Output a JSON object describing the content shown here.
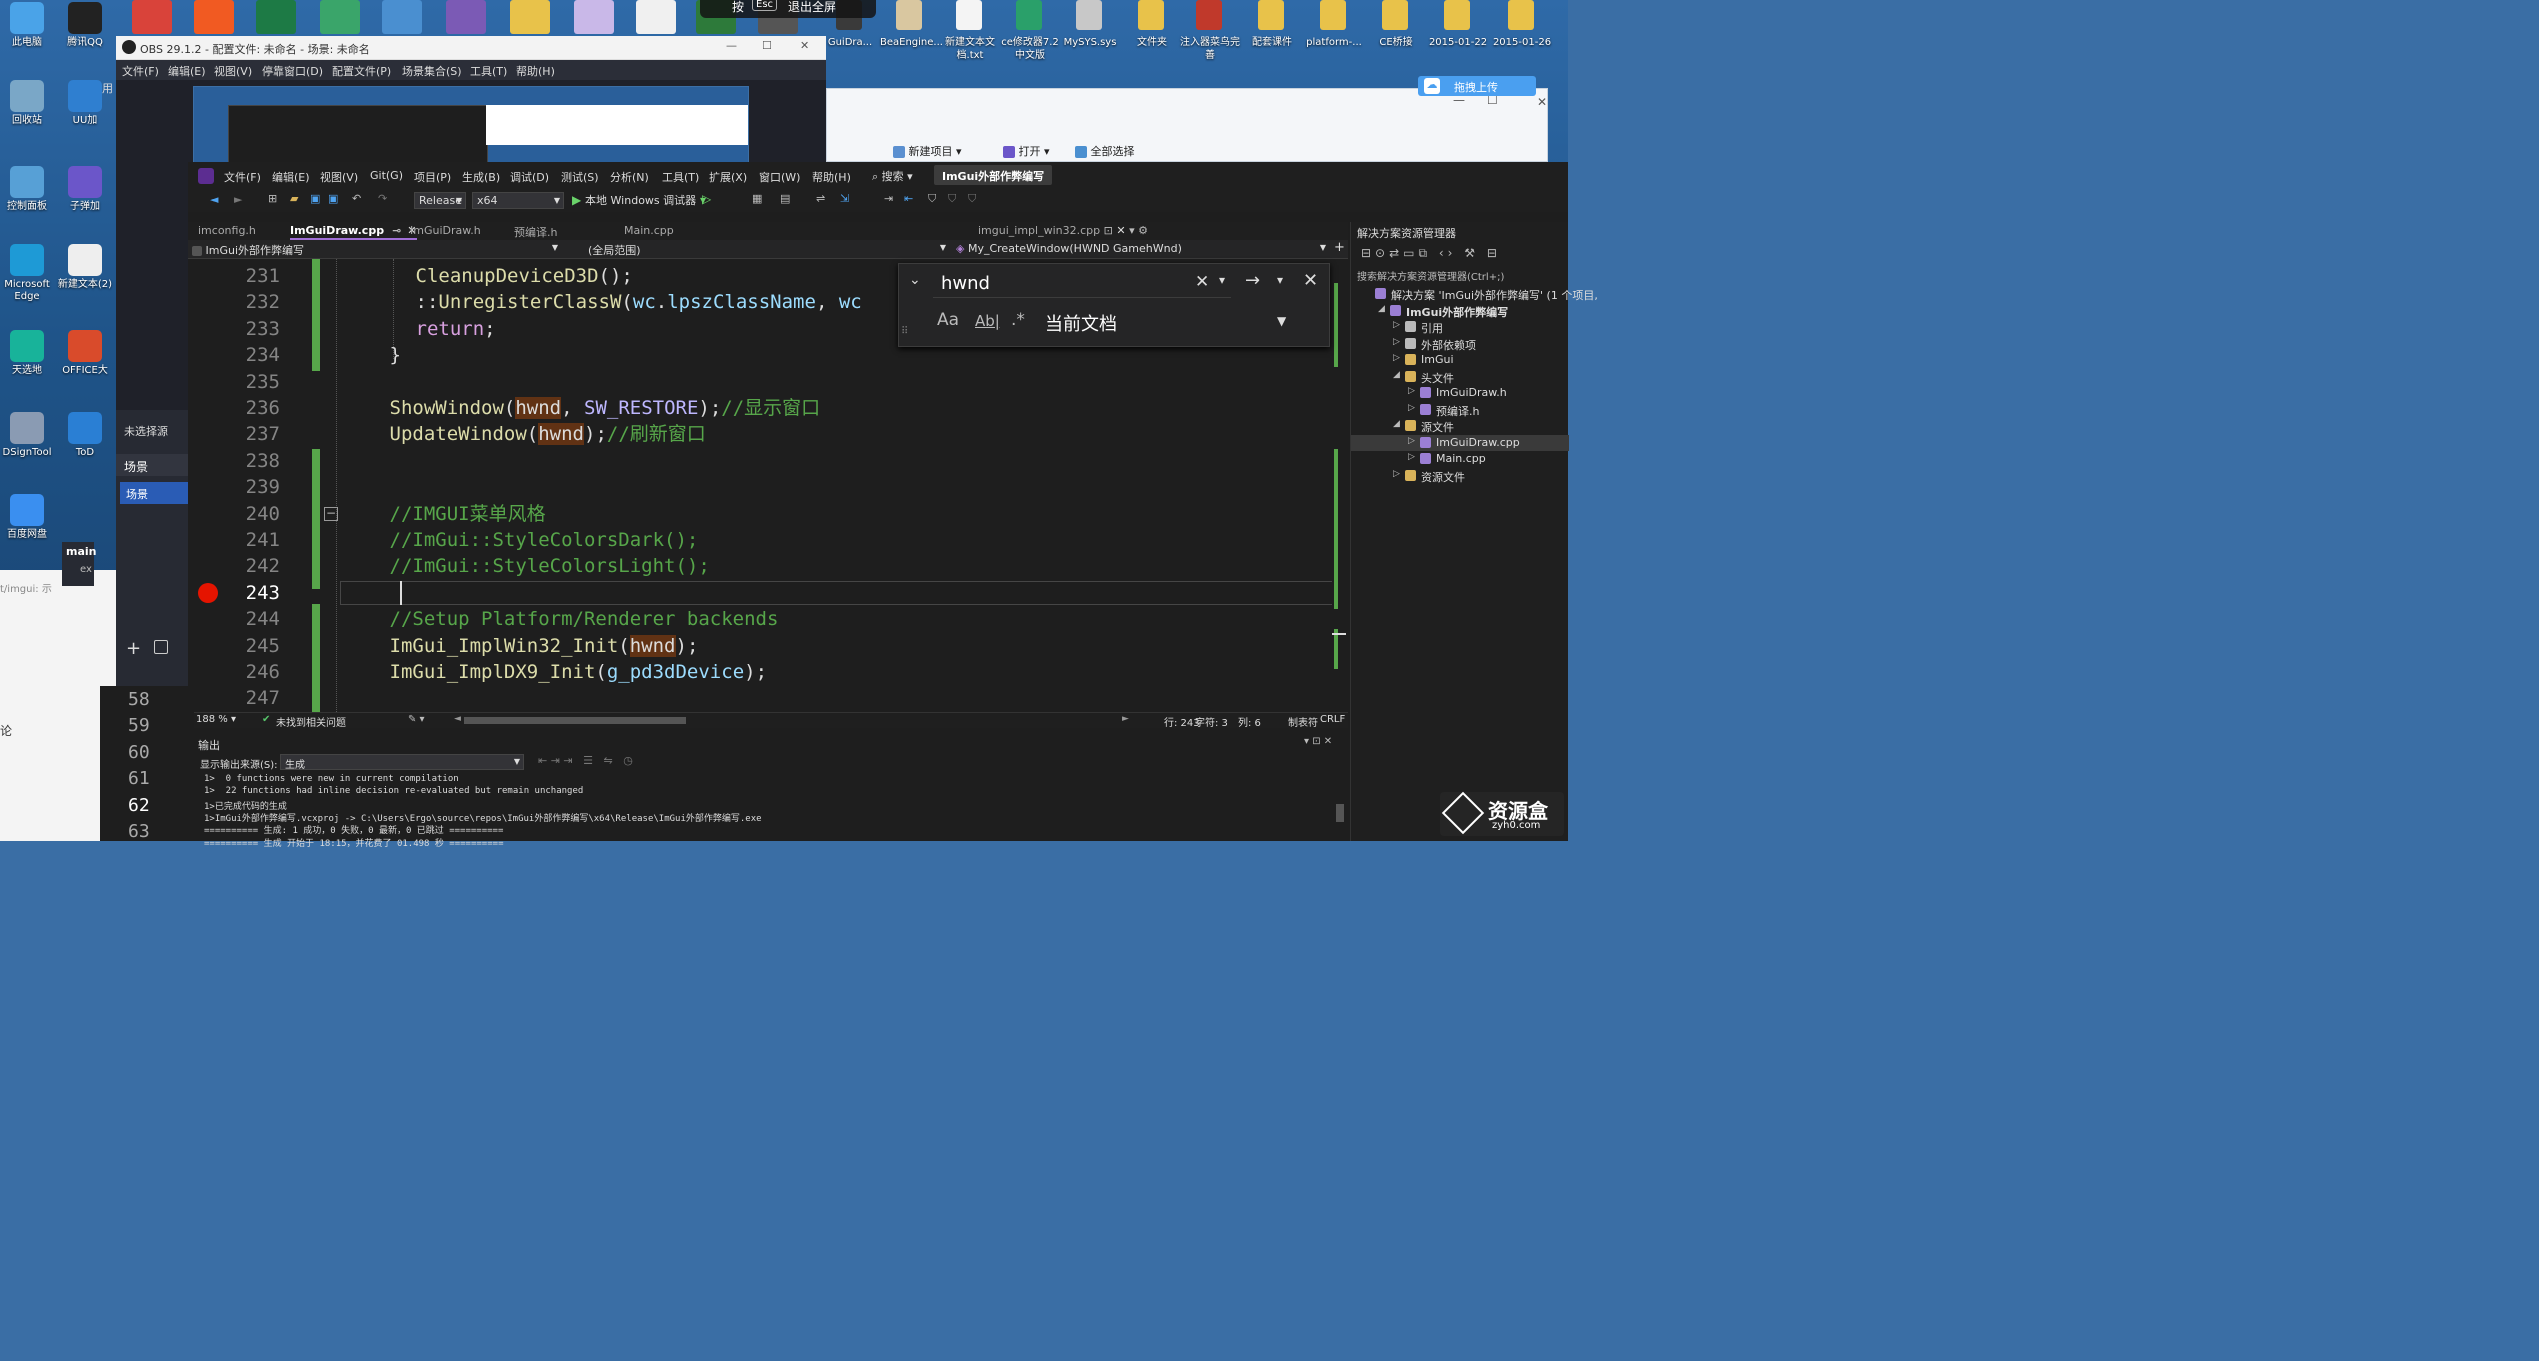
{
  "desktop": {
    "left_icons": [
      {
        "label": "此电脑",
        "color": "#4aa3e8"
      },
      {
        "label": "腾讯QQ",
        "color": "#222"
      },
      {
        "label": "回收站",
        "color": "#7aa7c7"
      },
      {
        "label": "UU加",
        "color": "#2f7fd0"
      },
      {
        "label": "控制面板",
        "color": "#57a0d6"
      },
      {
        "label": "子弹加",
        "color": "#6b56c9"
      },
      {
        "label": "Microsoft Edge",
        "color": "#1e9ad6"
      },
      {
        "label": "新建文本(2)",
        "color": "#eeeeee"
      },
      {
        "label": "天选地",
        "color": "#18b39a"
      },
      {
        "label": "OFFICE大",
        "color": "#d94b2b"
      },
      {
        "label": "DSignTool",
        "color": "#8a9bb3"
      },
      {
        "label": "ToD",
        "color": "#2a7fd4"
      },
      {
        "label": "百度网盘",
        "color": "#3a8ff0"
      }
    ],
    "top_icons": [
      {
        "color": "#d9433a"
      },
      {
        "color": "#f15a22"
      },
      {
        "color": "#1d7a45"
      },
      {
        "color": "#3aa56a"
      },
      {
        "color": "#4a8fd0"
      },
      {
        "color": "#7b5ab5"
      },
      {
        "color": "#e8c24a"
      },
      {
        "color": "#c9b8e8"
      },
      {
        "color": "#f0f0f0"
      },
      {
        "color": "#2d7a3a"
      },
      {
        "color": "#555555"
      }
    ],
    "top_right_icons": [
      {
        "label": "GuiDra...",
        "color": "#3a3a3a"
      },
      {
        "label": "BeaEngine...",
        "color": "#d9c7a0"
      },
      {
        "label": "新建文本文档.txt",
        "color": "#f4f4f4"
      },
      {
        "label": "ce修改器7.2中文版",
        "color": "#2aa06a"
      },
      {
        "label": "MySYS.sys",
        "color": "#c8c8c8"
      },
      {
        "label": "文件夹",
        "color": "#e8c24a"
      },
      {
        "label": "注入器菜鸟完善",
        "color": "#c0392b"
      },
      {
        "label": "配套课件",
        "color": "#e8c24a"
      },
      {
        "label": "platform-...",
        "color": "#e8c24a"
      },
      {
        "label": "CE桥接",
        "color": "#e8c24a"
      },
      {
        "label": "2015-01-22",
        "color": "#e8c24a"
      },
      {
        "label": "2015-01-26",
        "color": "#e8c24a"
      }
    ],
    "esc_hint": {
      "key": "Esc",
      "text": "退出全屏",
      "prefix": "按"
    }
  },
  "explorer": {
    "upload_label": "拖拽上传",
    "buttons": [
      "新建项目",
      "打开",
      "全部选择"
    ]
  },
  "obs": {
    "title": "OBS 29.1.2 - 配置文件: 未命名 - 场景: 未命名",
    "menu": [
      "文件(F)",
      "编辑(E)",
      "视图(V)",
      "停靠窗口(D)",
      "配置文件(P)",
      "场景集合(S)",
      "工具(T)",
      "帮助(H)"
    ],
    "side_labels": [
      "未选择源",
      "场景",
      "场景"
    ],
    "left_text": "用",
    "tab_main": "main",
    "tab_ex": "ex"
  },
  "left_panel": {
    "path": "t/imgui: 示",
    "label_lun": "论",
    "line_numbers": [
      "58",
      "59",
      "60",
      "61",
      "62",
      "63"
    ]
  },
  "vs": {
    "menu": [
      "文件(F)",
      "编辑(E)",
      "视图(V)",
      "Git(G)",
      "项目(P)",
      "生成(B)",
      "调试(D)",
      "测试(S)",
      "分析(N)",
      "工具(T)",
      "扩展(X)",
      "窗口(W)",
      "帮助(H)"
    ],
    "search_label": "搜索",
    "project_name": "ImGui外部作弊编写",
    "config": "Release",
    "platform": "x64",
    "run_label": "本地 Windows 调试器",
    "tabs": [
      {
        "label": "imconfig.h",
        "active": false
      },
      {
        "label": "ImGuiDraw.cpp",
        "active": true
      },
      {
        "label": "ImGuiDraw.h",
        "active": false
      },
      {
        "label": "预编译.h",
        "active": false
      },
      {
        "label": "Main.cpp",
        "active": false
      }
    ],
    "right_tab": "imgui_impl_win32.cpp",
    "nav_project": "ImGui外部作弊编写",
    "nav_scope": "(全局范围)",
    "nav_function": "My_CreateWindow(HWND GamehWnd)",
    "find": {
      "text": "hwnd",
      "scope": "当前文档",
      "opt_case": "Aa",
      "opt_word": "Ab|",
      "opt_regex": ".*"
    },
    "status": {
      "zoom": "188 %",
      "issues": "未找到相关问题",
      "line": "行: 243",
      "char": "字符: 3",
      "col": "列: 6",
      "tabs": "制表符",
      "eol": "CRLF"
    },
    "output": {
      "title": "输出",
      "source_label": "显示输出来源(S):",
      "source_value": "生成",
      "lines": [
        "1>  0 functions were new in current compilation",
        "1>  22 functions had inline decision re-evaluated but remain unchanged",
        "1>已完成代码的生成",
        "1>ImGui外部作弊编写.vcxproj -> C:\\Users\\Ergo\\source\\repos\\ImGui外部作弊编写\\x64\\Release\\ImGui外部作弊编写.exe",
        "========== 生成: 1 成功，0 失败，0 最新，0 已跳过 ==========",
        "========== 生成 开始于 18:15，并花费了 01.498 秒 =========="
      ]
    },
    "solution": {
      "title": "解决方案资源管理器",
      "search": "搜索解决方案资源管理器(Ctrl+;)",
      "items": [
        {
          "label": "解决方案 'ImGui外部作弊编写' (1 个项目,",
          "indent": 0,
          "bold": false,
          "color": "#9b7fd4"
        },
        {
          "label": "ImGui外部作弊编写",
          "indent": 1,
          "bold": true,
          "color": "#9b7fd4"
        },
        {
          "label": "引用",
          "indent": 2,
          "bold": false,
          "color": "#bbbbbb"
        },
        {
          "label": "外部依赖项",
          "indent": 2,
          "bold": false,
          "color": "#bbbbbb"
        },
        {
          "label": "ImGui",
          "indent": 2,
          "bold": false,
          "color": "#d9b35a"
        },
        {
          "label": "头文件",
          "indent": 2,
          "bold": false,
          "color": "#d9b35a"
        },
        {
          "label": "ImGuiDraw.h",
          "indent": 3,
          "bold": false,
          "color": "#9b7fd4"
        },
        {
          "label": "预编译.h",
          "indent": 3,
          "bold": false,
          "color": "#9b7fd4"
        },
        {
          "label": "源文件",
          "indent": 2,
          "bold": false,
          "color": "#d9b35a"
        },
        {
          "label": "ImGuiDraw.cpp",
          "indent": 3,
          "bold": false,
          "color": "#9b7fd4",
          "selected": true
        },
        {
          "label": "Main.cpp",
          "indent": 3,
          "bold": false,
          "color": "#9b7fd4"
        },
        {
          "label": "资源文件",
          "indent": 2,
          "bold": false,
          "color": "#d9b35a"
        }
      ]
    },
    "code_lines": [
      {
        "no": "231",
        "html": "<span class=\"f\">CleanupDeviceD3D</span>();",
        "indent": 11
      },
      {
        "no": "232",
        "html": "::<span class=\"f\">UnregisterClassW</span>(<span class=\"v\">wc</span>.<span class=\"v\">lpszClassName</span>, <span class=\"v\">wc</span>",
        "indent": 11
      },
      {
        "no": "233",
        "html": "<span class=\"k\">return</span>;",
        "indent": 11
      },
      {
        "no": "234",
        "html": "}",
        "indent": 7
      },
      {
        "no": "235",
        "html": "",
        "indent": 0
      },
      {
        "no": "236",
        "html": "<span class=\"f\">ShowWindow</span>(<span class=\"hl\">hwnd</span>, <span class=\"m\">SW_RESTORE</span>);<span class=\"c\">//显示窗口</span>",
        "indent": 7
      },
      {
        "no": "237",
        "html": "<span class=\"f\">UpdateWindow</span>(<span class=\"hl\">hwnd</span>);<span class=\"c\">//刷新窗口</span>",
        "indent": 7
      },
      {
        "no": "238",
        "html": "",
        "indent": 0
      },
      {
        "no": "239",
        "html": "",
        "indent": 0
      },
      {
        "no": "240",
        "html": "<span class=\"c\">//IMGUI菜单风格</span>",
        "indent": 7
      },
      {
        "no": "241",
        "html": "<span class=\"c\">//ImGui::StyleColorsDark();</span>",
        "indent": 7
      },
      {
        "no": "242",
        "html": "<span class=\"c\">//ImGui::StyleColorsLight();</span>",
        "indent": 7
      },
      {
        "no": "243",
        "html": "",
        "indent": 0,
        "current": true
      },
      {
        "no": "244",
        "html": "<span class=\"c\">//Setup Platform/Renderer backends</span>",
        "indent": 7
      },
      {
        "no": "245",
        "html": "<span class=\"f\">ImGui_ImplWin32_Init</span>(<span class=\"hl\">hwnd</span>);",
        "indent": 7
      },
      {
        "no": "246",
        "html": "<span class=\"f\">ImGui_ImplDX9_Init</span>(<span class=\"v\">g_pd3dDevice</span>);",
        "indent": 7
      },
      {
        "no": "247",
        "html": "",
        "indent": 0
      }
    ]
  },
  "watermark": {
    "text": "资源盒",
    "sub": "zyh0.com"
  }
}
